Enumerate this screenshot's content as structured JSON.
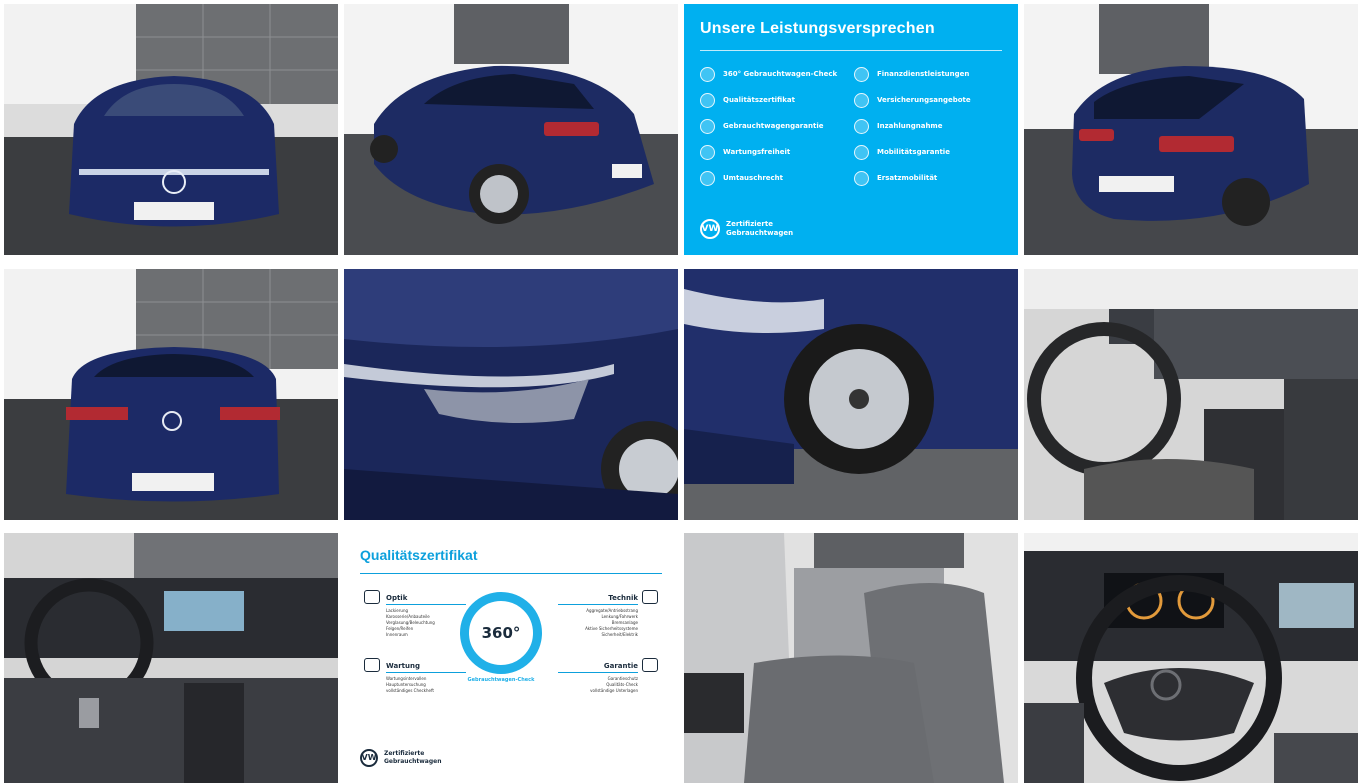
{
  "gallery": {
    "photos": [
      {
        "name": "front-view"
      },
      {
        "name": "rear-left-view"
      },
      {
        "name": "rear-right-view"
      },
      {
        "name": "rear-view"
      },
      {
        "name": "headlight-detail"
      },
      {
        "name": "front-wheel-detail"
      },
      {
        "name": "interior-driver-side"
      },
      {
        "name": "cockpit-view"
      },
      {
        "name": "rear-seats"
      },
      {
        "name": "steering-wheel-closeup"
      }
    ]
  },
  "promise": {
    "title": "Unsere Leistungsversprechen",
    "left": [
      "360° Gebrauchtwagen-Check",
      "Qualitätszertifikat",
      "Gebrauchtwagengarantie",
      "Wartungsfreiheit",
      "Umtauschrecht"
    ],
    "right": [
      "Finanzdienstleistungen",
      "Versicherungsangebote",
      "Inzahlungnahme",
      "Mobilitätsgarantie",
      "Ersatzmobilität"
    ],
    "footer_line1": "Zertifizierte",
    "footer_line2": "Gebrauchtwagen"
  },
  "quality": {
    "title": "Qualitätszertifikat",
    "center": "360°",
    "ring_text": "Gebrauchtwagen-Check",
    "optik": {
      "heading": "Optik",
      "items": [
        "Lackierung",
        "Karosserie/Anbauteile",
        "Verglasung/Beleuchtung",
        "Felgen/Reifen",
        "Innenraum"
      ]
    },
    "technik": {
      "heading": "Technik",
      "items": [
        "Aggregate/Antriebsstrang",
        "Lenkung/Fahrwerk",
        "Bremsanlage",
        "Aktive Sicherheitssysteme",
        "Sicherheit/Elektrik"
      ]
    },
    "wartung": {
      "heading": "Wartung",
      "items": [
        "Wartungsintervallen",
        "Hauptuntersuchung",
        "vollständiges Checkheft"
      ]
    },
    "garantie": {
      "heading": "Garantie",
      "items": [
        "Garantieschutz",
        "Qualitäts-Check",
        "vollständige Unterlagen"
      ]
    },
    "footer_line1": "Zertifizierte",
    "footer_line2": "Gebrauchtwagen"
  },
  "colors": {
    "vw_blue": "#00b0f0",
    "car_blue": "#1c2a66"
  }
}
